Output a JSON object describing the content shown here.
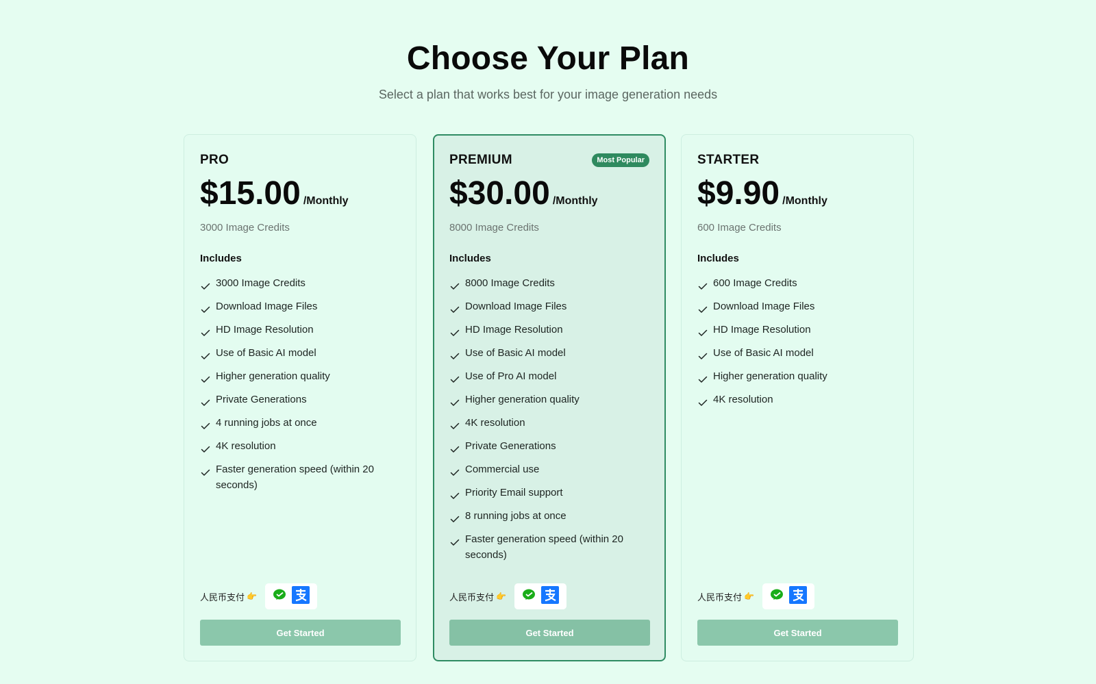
{
  "header": {
    "title": "Choose Your Plan",
    "subtitle": "Select a plan that works best for your image generation needs"
  },
  "plans": [
    {
      "name": "PRO",
      "price": "$15.00",
      "period": "/Monthly",
      "credits": "3000 Image Credits",
      "includes_label": "Includes",
      "features": [
        "3000 Image Credits",
        "Download Image Files",
        "HD Image Resolution",
        "Use of Basic AI model",
        "Higher generation quality",
        "Private Generations",
        "4 running jobs at once",
        "4K resolution",
        "Faster generation speed (within 20 seconds)"
      ],
      "payment_label": "人民币支付",
      "payment_pointer": "👉",
      "cta": "Get Started"
    },
    {
      "name": "PREMIUM",
      "badge": "Most Popular",
      "price": "$30.00",
      "period": "/Monthly",
      "credits": "8000 Image Credits",
      "includes_label": "Includes",
      "features": [
        "8000 Image Credits",
        "Download Image Files",
        "HD Image Resolution",
        "Use of Basic AI model",
        "Use of Pro AI model",
        "Higher generation quality",
        "4K resolution",
        "Private Generations",
        "Commercial use",
        "Priority Email support",
        "8 running jobs at once",
        "Faster generation speed (within 20 seconds)"
      ],
      "payment_label": "人民币支付",
      "payment_pointer": "👉",
      "cta": "Get Started"
    },
    {
      "name": "STARTER",
      "price": "$9.90",
      "period": "/Monthly",
      "credits": "600 Image Credits",
      "includes_label": "Includes",
      "features": [
        "600 Image Credits",
        "Download Image Files",
        "HD Image Resolution",
        "Use of Basic AI model",
        "Higher generation quality",
        "4K resolution"
      ],
      "payment_label": "人民币支付",
      "payment_pointer": "👉",
      "cta": "Get Started"
    }
  ],
  "colors": {
    "page_background": "#e5fdf1",
    "featured_border": "#2e8b62",
    "badge": "#2f8a5f",
    "button": "#8bc7ab",
    "wechat": "#1aad19",
    "alipay": "#1677ff"
  },
  "icons": {
    "feature": "check-icon",
    "payment": [
      "wechat-pay-icon",
      "alipay-icon"
    ]
  }
}
